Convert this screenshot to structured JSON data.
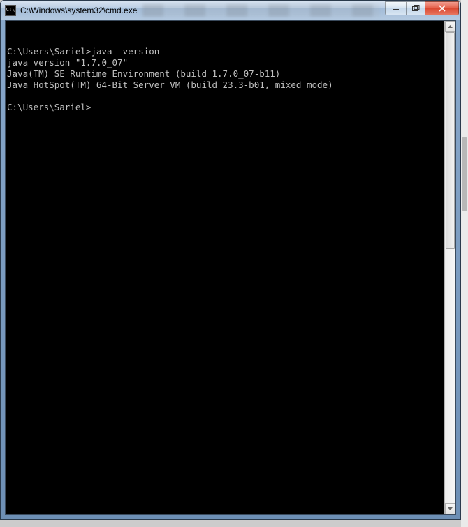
{
  "window": {
    "icon_label": "C:\\",
    "title": "C:\\Windows\\system32\\cmd.exe"
  },
  "terminal": {
    "prompt1": "C:\\Users\\Sariel>",
    "command1": "java -version",
    "out_line1": "java version \"1.7.0_07\"",
    "out_line2": "Java(TM) SE Runtime Environment (build 1.7.0_07-b11)",
    "out_line3": "Java HotSpot(TM) 64-Bit Server VM (build 23.3-b01, mixed mode)",
    "blank": "",
    "prompt2": "C:\\Users\\Sariel>"
  }
}
